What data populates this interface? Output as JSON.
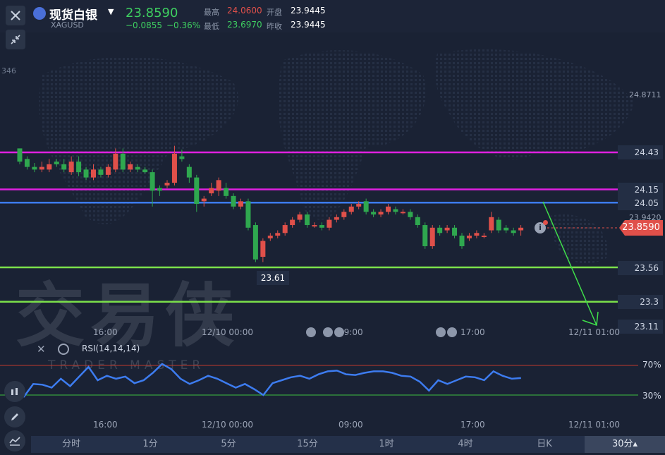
{
  "header": {
    "title": "现货白银",
    "symbol": "XAGUSD",
    "price": "23.8590",
    "change": "−0.0855",
    "change_pct": "−0.36%",
    "high_label": "最高",
    "high": "24.0600",
    "low_label": "最低",
    "low": "23.6970",
    "open_label": "开盘",
    "open": "23.9445",
    "prev_label": "昨收",
    "prev": "23.9445"
  },
  "axis": {
    "y_top": "24.8711",
    "y_mid": "23.9420",
    "left_partial": "346",
    "current_price": "23.8590",
    "low_marker": "23.61"
  },
  "levels": [
    {
      "label": "24.43",
      "value": 24.43,
      "color": "#e020e0"
    },
    {
      "label": "24.15",
      "value": 24.15,
      "color": "#e020e0"
    },
    {
      "label": "24.05",
      "value": 24.05,
      "color": "#3d7cf0"
    },
    {
      "label": "23.56",
      "value": 23.56,
      "color": "#7be04a"
    },
    {
      "label": "23.3",
      "value": 23.3,
      "color": "#7be04a"
    },
    {
      "label": "23.11",
      "value": 23.11,
      "color": "#7be04a"
    }
  ],
  "time_labels": [
    "16:00",
    "12/10 00:00",
    "09:00",
    "17:00",
    "12/11 01:00"
  ],
  "rsi": {
    "label": "RSI(14,14,14)",
    "upper_label": "70%",
    "lower_label": "30%",
    "upper_color": "#c0392b",
    "lower_color": "#3fbf3f"
  },
  "watermark": {
    "main": "交易侠",
    "sub": "TRADER MASTER"
  },
  "timeframes": [
    "分时",
    "1分",
    "5分",
    "15分",
    "1时",
    "4时",
    "日K",
    "30分▴"
  ],
  "selected_timeframe": "30分▴",
  "colors": {
    "up": "#e0504a",
    "down": "#2fa84f",
    "bg": "#1a2234",
    "rsi_line": "#3d7cf0"
  },
  "chart_data": {
    "type": "candlestick",
    "interval": "30分",
    "price_range": [
      23.0,
      24.9
    ],
    "candles": [
      [
        24.46,
        24.36,
        24.4,
        24.34
      ],
      [
        24.38,
        24.32,
        24.4,
        24.3
      ],
      [
        24.32,
        24.3,
        24.35,
        24.28
      ],
      [
        24.3,
        24.32,
        24.36,
        24.28
      ],
      [
        24.3,
        24.34,
        24.38,
        24.28
      ],
      [
        24.36,
        24.34,
        24.38,
        24.32
      ],
      [
        24.34,
        24.3,
        24.38,
        24.28
      ],
      [
        24.28,
        24.36,
        24.4,
        24.26
      ],
      [
        24.36,
        24.28,
        24.4,
        24.25
      ],
      [
        24.3,
        24.24,
        24.32,
        24.22
      ],
      [
        24.24,
        24.3,
        24.34,
        24.22
      ],
      [
        24.3,
        24.26,
        24.32,
        24.24
      ],
      [
        24.26,
        24.32,
        24.34,
        24.24
      ],
      [
        24.3,
        24.42,
        24.46,
        24.28
      ],
      [
        24.42,
        24.3,
        24.46,
        24.28
      ],
      [
        24.3,
        24.34,
        24.36,
        24.28
      ],
      [
        24.32,
        24.3,
        24.34,
        24.28
      ],
      [
        24.3,
        24.28,
        24.32,
        24.27
      ],
      [
        24.28,
        24.14,
        24.3,
        24.02
      ],
      [
        24.16,
        24.14,
        24.18,
        24.1
      ],
      [
        24.18,
        24.2,
        24.22,
        24.16
      ],
      [
        24.2,
        24.42,
        24.48,
        24.18
      ],
      [
        24.4,
        24.38,
        24.45,
        24.36
      ],
      [
        24.32,
        24.24,
        24.34,
        24.2
      ],
      [
        24.24,
        24.04,
        24.26,
        23.98
      ],
      [
        24.06,
        24.08,
        24.1,
        24.02
      ],
      [
        24.12,
        24.16,
        24.2,
        24.1
      ],
      [
        24.14,
        24.22,
        24.24,
        24.1
      ],
      [
        24.16,
        24.1,
        24.2,
        24.08
      ],
      [
        24.1,
        24.02,
        24.12,
        24.0
      ],
      [
        24.02,
        24.06,
        24.08,
        24.0
      ],
      [
        24.06,
        23.86,
        24.08,
        23.84
      ],
      [
        23.88,
        23.62,
        23.9,
        23.6
      ],
      [
        23.64,
        23.76,
        23.78,
        23.6
      ],
      [
        23.78,
        23.8,
        23.82,
        23.76
      ],
      [
        23.8,
        23.82,
        23.84,
        23.78
      ],
      [
        23.82,
        23.88,
        23.9,
        23.8
      ],
      [
        23.88,
        23.92,
        23.94,
        23.86
      ],
      [
        23.92,
        23.96,
        23.98,
        23.9
      ],
      [
        23.96,
        23.88,
        23.98,
        23.86
      ],
      [
        23.88,
        23.88,
        23.9,
        23.86
      ],
      [
        23.88,
        23.86,
        23.9,
        23.84
      ],
      [
        23.86,
        23.92,
        23.94,
        23.84
      ],
      [
        23.92,
        23.94,
        23.96,
        23.9
      ],
      [
        23.94,
        23.98,
        24.0,
        23.92
      ],
      [
        23.98,
        24.02,
        24.04,
        23.96
      ],
      [
        24.02,
        24.04,
        24.06,
        24.0
      ],
      [
        24.06,
        23.98,
        24.08,
        23.96
      ],
      [
        23.98,
        23.96,
        24.0,
        23.94
      ],
      [
        23.96,
        23.98,
        24.0,
        23.94
      ],
      [
        23.98,
        24.02,
        24.04,
        23.96
      ],
      [
        24.0,
        23.98,
        24.02,
        23.96
      ],
      [
        23.98,
        23.98,
        24.0,
        23.96
      ],
      [
        23.98,
        23.94,
        24.0,
        23.92
      ],
      [
        23.94,
        23.88,
        23.96,
        23.86
      ],
      [
        23.88,
        23.72,
        23.9,
        23.7
      ],
      [
        23.72,
        23.86,
        23.88,
        23.7
      ],
      [
        23.86,
        23.82,
        23.88,
        23.8
      ],
      [
        23.84,
        23.86,
        23.88,
        23.82
      ],
      [
        23.86,
        23.8,
        23.88,
        23.78
      ],
      [
        23.8,
        23.72,
        23.82,
        23.7
      ],
      [
        23.78,
        23.8,
        23.82,
        23.76
      ],
      [
        23.8,
        23.82,
        23.84,
        23.78
      ],
      [
        23.8,
        23.8,
        23.82,
        23.78
      ],
      [
        23.84,
        23.94,
        23.98,
        23.82
      ],
      [
        23.92,
        23.84,
        23.94,
        23.82
      ],
      [
        23.86,
        23.84,
        23.88,
        23.82
      ],
      [
        23.84,
        23.82,
        23.86,
        23.8
      ],
      [
        23.84,
        23.86,
        23.88,
        23.8
      ]
    ],
    "rsi": [
      38,
      30,
      28,
      45,
      44,
      40,
      52,
      42,
      55,
      68,
      50,
      56,
      52,
      55,
      46,
      50,
      60,
      72,
      65,
      52,
      45,
      50,
      56,
      52,
      46,
      40,
      45,
      38,
      30,
      46,
      50,
      54,
      56,
      52,
      58,
      62,
      63,
      58,
      57,
      60,
      62,
      62,
      60,
      56,
      55,
      48,
      36,
      50,
      45,
      50,
      55,
      54,
      50,
      62,
      56,
      52,
      53
    ]
  }
}
